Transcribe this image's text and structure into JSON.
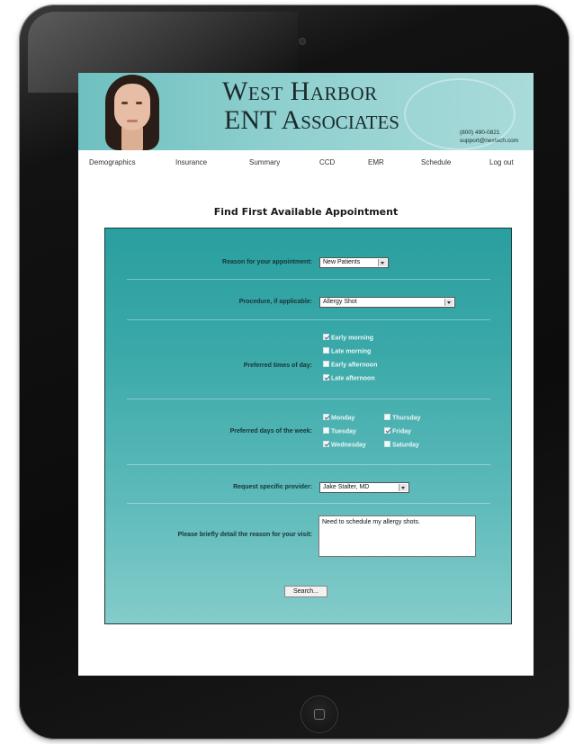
{
  "brand": {
    "line1": "West Harbor",
    "line2": "ENT Associates"
  },
  "contact": {
    "phone": "(800) 490-0821",
    "email": "support@nextech.com"
  },
  "nav": [
    "Demographics",
    "Insurance",
    "Summary",
    "CCD",
    "EMR",
    "Schedule",
    "Log out"
  ],
  "page_title": "Find First Available Appointment",
  "form": {
    "reason": {
      "label": "Reason for your appointment:",
      "value": "New Patients"
    },
    "procedure": {
      "label": "Procedure, if applicable:",
      "value": "Allergy Shot"
    },
    "times": {
      "label": "Preferred times of day:",
      "options": [
        {
          "label": "Early morning",
          "checked": true
        },
        {
          "label": "Late morning",
          "checked": false
        },
        {
          "label": "Early afternoon",
          "checked": false
        },
        {
          "label": "Late afternoon",
          "checked": true
        }
      ]
    },
    "days": {
      "label": "Preferred days of the week:",
      "options": [
        {
          "label": "Monday",
          "checked": true
        },
        {
          "label": "Thursday",
          "checked": false
        },
        {
          "label": "Tuesday",
          "checked": false
        },
        {
          "label": "Friday",
          "checked": true
        },
        {
          "label": "Wednesday",
          "checked": true
        },
        {
          "label": "Saturday",
          "checked": false
        }
      ]
    },
    "provider": {
      "label": "Request specific provider:",
      "value": "Jake Stalter, MD"
    },
    "detail": {
      "label": "Please briefly detail the reason for your visit:",
      "value": "Need to schedule my allergy shots."
    },
    "search_label": "Search..."
  },
  "colors": {
    "banner": "#8fd0cf",
    "panel_top": "#2a9f9f",
    "panel_bottom": "#84cccb"
  }
}
